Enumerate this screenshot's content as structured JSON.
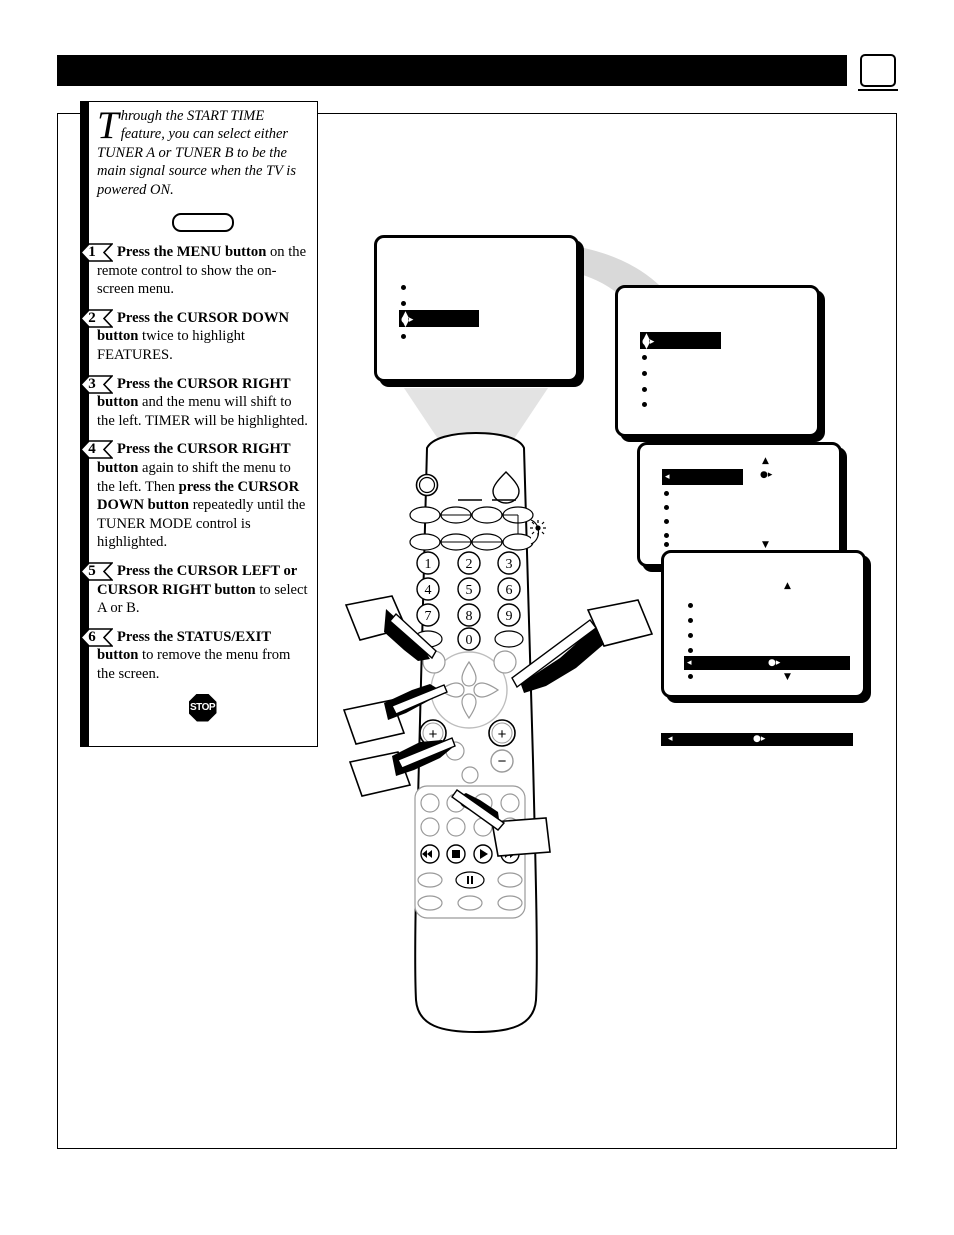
{
  "document": {
    "header_bar_label": "",
    "page_number": ""
  },
  "instruction": {
    "intro": {
      "dropcap": "T",
      "text": "hrough the START TIME feature, you can select either TUNER A or TUNER B to be the main signal source when the TV is powered ON."
    },
    "menu_pill_label": "",
    "steps": [
      {
        "number": "1",
        "bold_lead": "Press the MENU button",
        "rest": " on the remote control to show the on-screen menu."
      },
      {
        "number": "2",
        "bold_lead": "Press the CURSOR DOWN button",
        "rest": " twice to highlight FEATURES."
      },
      {
        "number": "3",
        "bold_lead": "Press the CURSOR RIGHT button",
        "rest": " and the menu will shift to the left. TIMER will be highlighted."
      },
      {
        "number": "4",
        "bold_lead": "Press the CURSOR RIGHT button",
        "rest_a": " again to shift the menu to the left. Then ",
        "bold_mid": "press the CURSOR DOWN button",
        "rest_b": " repeatedly until the TUNER MODE control is highlighted."
      },
      {
        "number": "5",
        "bold_lead": "Press the CURSOR LEFT or CURSOR RIGHT button",
        "rest": " to select A or B."
      },
      {
        "number": "6",
        "bold_lead": "Press the STATUS/EXIT button",
        "rest": " to remove the menu from the screen."
      }
    ],
    "stop_label": "STOP"
  },
  "screens": [
    {
      "id": "screen-main-menu",
      "caption": "",
      "items": [
        "",
        "",
        "",
        ""
      ],
      "highlighted_index": 2,
      "highlight_label": ""
    },
    {
      "id": "screen-features",
      "caption": "",
      "items": [
        "",
        "",
        "",
        "",
        ""
      ],
      "highlighted_index": 0,
      "highlight_label": ""
    },
    {
      "id": "screen-timer",
      "caption": "",
      "items": [
        "",
        "",
        "",
        "",
        "",
        ""
      ],
      "highlighted_index": 0,
      "highlight_label": ""
    },
    {
      "id": "screen-tuner-mode",
      "caption": "",
      "items": [
        "",
        "",
        "",
        "",
        "",
        ""
      ],
      "highlighted_index": 4,
      "highlight_label": ""
    }
  ],
  "standalone_bar": {
    "label": ""
  },
  "remote": {
    "name": "remote-control",
    "keypad": [
      "1",
      "2",
      "3",
      "4",
      "5",
      "6",
      "7",
      "8",
      "9",
      "0"
    ],
    "transport": {
      "rewind": "◀◀",
      "stop": "■",
      "play": "▶",
      "forward": "▶▶",
      "pause": "‖"
    },
    "volume_up": "+",
    "volume_down": "−",
    "channel_up": "+",
    "light_icon": "☀"
  },
  "colors": {
    "ink": "#000000",
    "paper": "#ffffff",
    "beam": "#d8d8d8"
  }
}
